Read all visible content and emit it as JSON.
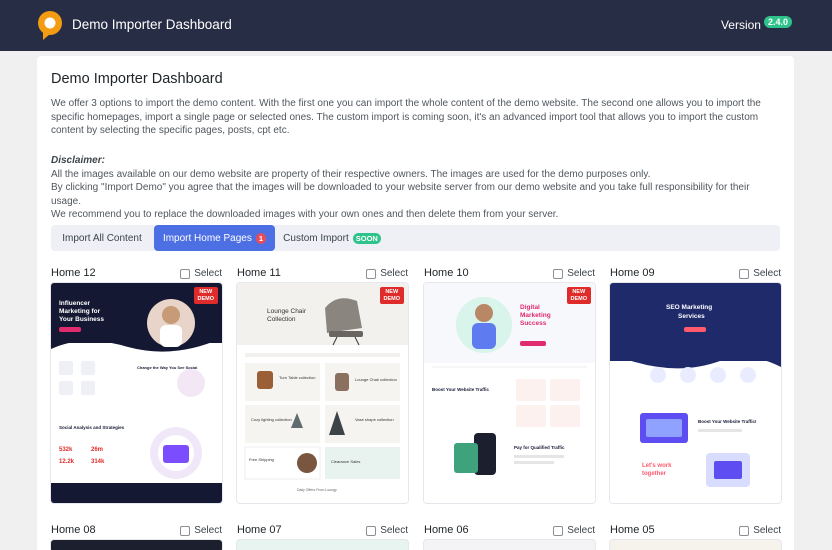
{
  "header": {
    "app_title": "Demo Importer Dashboard",
    "version_label": "Version",
    "version_number": "2.4.0",
    "logo_icon": "chat-bubble-logo-icon"
  },
  "panel": {
    "title": "Demo Importer Dashboard",
    "intro": "We offer 3 options to import the demo content. With the first one you can import the whole content of the demo website. The second one allows you to import the specific homepages, import a single page or selected ones. The custom import is coming soon, it's an advanced import tool that allows you to import the custom content by selecting the specific pages, posts, cpt etc.",
    "disclaimer_title": "Disclaimer:",
    "disclaimer_lines": [
      "All the images available on our demo website are property of their respective owners. The images are used for the demo purposes only.",
      "By clicking \"Import Demo\" you agree that the images will be downloaded to your website server from our demo website and you take full responsibility for their usage.",
      "We recommend you to replace the downloaded images with your own ones and then delete them from your server."
    ]
  },
  "tabs": [
    {
      "label": "Import All Content",
      "badge": ""
    },
    {
      "label": "Import Home Pages",
      "badge": "1"
    },
    {
      "label": "Custom Import",
      "badge": "SOON"
    }
  ],
  "select_label": "Select",
  "new_demo_line1": "NEW",
  "new_demo_line2": "DEMO",
  "cards": [
    {
      "name": "Home 12",
      "new": true
    },
    {
      "name": "Home 11",
      "new": true
    },
    {
      "name": "Home 10",
      "new": true
    },
    {
      "name": "Home 09",
      "new": false
    },
    {
      "name": "Home 08",
      "new": false
    },
    {
      "name": "Home 07",
      "new": false
    },
    {
      "name": "Home 06",
      "new": false
    },
    {
      "name": "Home 05",
      "new": false
    }
  ],
  "thumb_text": {
    "h12_title": "Influencer Marketing for Your Business",
    "h12_sub": "Change the Way You See Social",
    "h12_sub2": "Social Analysis and Strategies",
    "h12_stats": [
      "532k",
      "26m",
      "12.2k",
      "314k"
    ],
    "h11_title": "Lounge Chair Collection",
    "h11_items": [
      "Turn Table collection",
      "Lounge Chair collection",
      "Cozy lighting collection",
      "Vase shape collection",
      "Free Shipping",
      "Clearance Sales"
    ],
    "h11_footer": "Daily Offers From Loungy",
    "h10_title": "Digital Marketing Success",
    "h10_sub": "Boost Your Website Traffic",
    "h10_sub2": "Pay for Qualified Traffic",
    "h09_title": "SEO Marketing Services",
    "h09_sub": "Boost Your Website Traffic!",
    "h09_sub2": "Let's work together"
  }
}
